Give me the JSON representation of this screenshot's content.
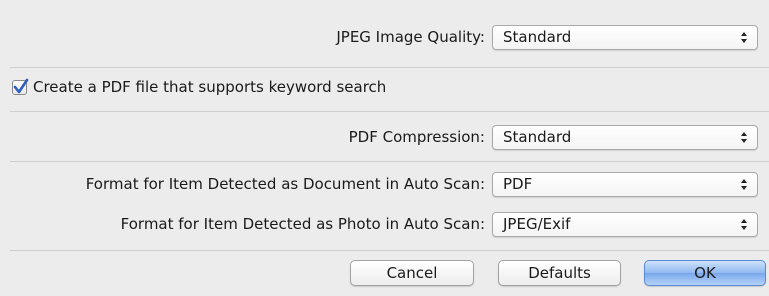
{
  "jpeg_quality": {
    "label": "JPEG Image Quality:",
    "value": "Standard"
  },
  "pdf_keyword_search": {
    "label": "Create a PDF file that supports keyword search",
    "checked": true
  },
  "pdf_compression": {
    "label": "PDF Compression:",
    "value": "Standard"
  },
  "format_document": {
    "label": "Format for Item Detected as Document in Auto Scan:",
    "value": "PDF"
  },
  "format_photo": {
    "label": "Format for Item Detected as Photo in Auto Scan:",
    "value": "JPEG/Exif"
  },
  "buttons": {
    "cancel": "Cancel",
    "defaults": "Defaults",
    "ok": "OK"
  },
  "icons": {
    "checkbox_check": "checkmark-icon",
    "select_arrows": "updown-arrows-icon"
  },
  "colors": {
    "ok_button": "#8fb8f1",
    "checkmark": "#2a5fbf",
    "background": "#ececec"
  }
}
